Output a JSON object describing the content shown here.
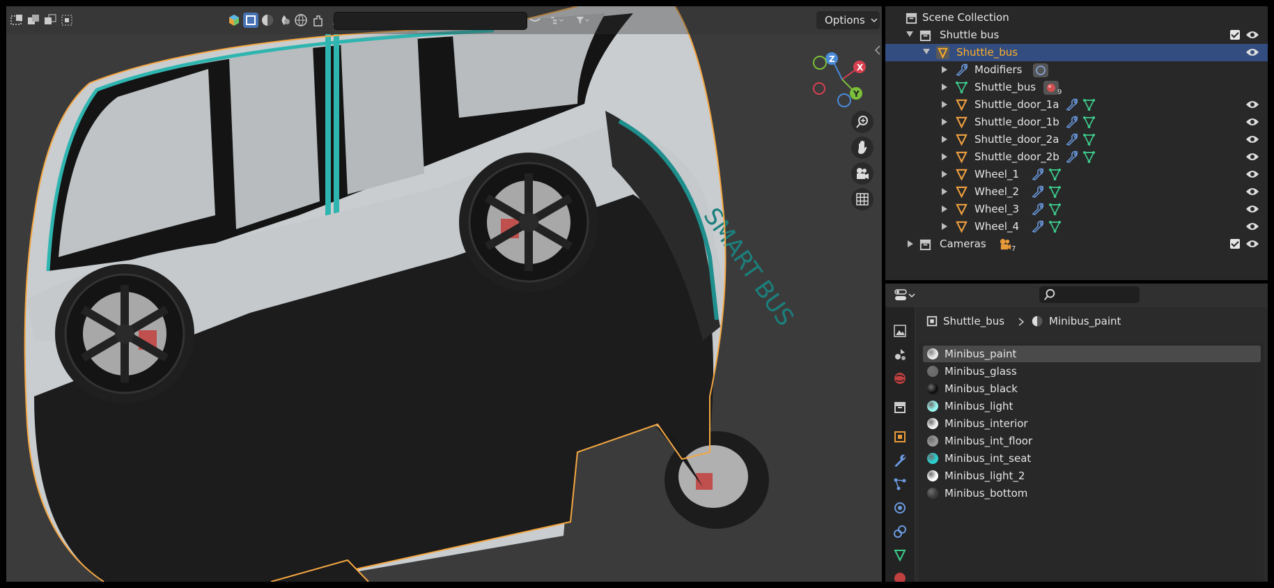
{
  "viewport": {
    "options_label": "Options",
    "gizmo": {
      "x": "X",
      "y": "Y",
      "z": "Z"
    },
    "decal_text": "SMART BUS"
  },
  "outliner": {
    "rows": [
      {
        "label": "Scene Collection"
      },
      {
        "label": "Shuttle bus"
      },
      {
        "label": "Shuttle_bus"
      },
      {
        "label": "Modifiers"
      },
      {
        "label": "Shuttle_bus",
        "badge": "9"
      },
      {
        "label": "Shuttle_door_1a"
      },
      {
        "label": "Shuttle_door_1b"
      },
      {
        "label": "Shuttle_door_2a"
      },
      {
        "label": "Shuttle_door_2b"
      },
      {
        "label": "Wheel_1"
      },
      {
        "label": "Wheel_2"
      },
      {
        "label": "Wheel_3"
      },
      {
        "label": "Wheel_4"
      },
      {
        "label": "Cameras",
        "badge": "7"
      }
    ]
  },
  "properties": {
    "breadcrumb": {
      "object": "Shuttle_bus",
      "material": "Minibus_paint"
    },
    "materials": [
      {
        "name": "Minibus_paint",
        "color": "#e8e8e8"
      },
      {
        "name": "Minibus_glass",
        "color": "#6a6a6a"
      },
      {
        "name": "Minibus_black",
        "color": "#111111"
      },
      {
        "name": "Minibus_light",
        "color": "#9af5f0"
      },
      {
        "name": "Minibus_interior",
        "color": "#f2f2f2"
      },
      {
        "name": "Minibus_int_floor",
        "color": "#9a9a9a"
      },
      {
        "name": "Minibus_int_seat",
        "color": "#2ad1d0"
      },
      {
        "name": "Minibus_light_2",
        "color": "#ffffff"
      },
      {
        "name": "Minibus_bottom",
        "color": "#3c3c3c"
      }
    ],
    "active_material": "Minibus_paint"
  },
  "colors": {
    "selection_outline": "#f5a742",
    "outliner_selected_row": "#334d80",
    "selected_text": "#ffaf29",
    "bus_body": "#c9cdd0",
    "bus_black": "#1c1c1c",
    "teal_stripe": "#2fb5b0"
  }
}
